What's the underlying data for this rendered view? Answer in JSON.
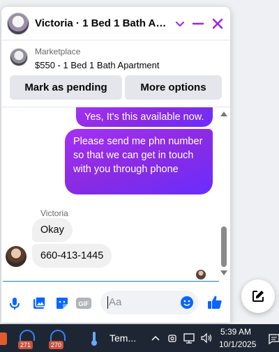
{
  "chat": {
    "title": "Victoria · 1 Bed 1 Bath Apa...",
    "product_label": "Marketplace",
    "product_title": "$550 - 1 Bed 1 Bath Apartment",
    "actions": {
      "mark_pending": "Mark as pending",
      "more_options": "More options"
    },
    "messages": {
      "out_1": "Yes, It's this available now.",
      "out_2": "Please send me  phn number so that we can get in touch with you through phone",
      "sender_name": "Victoria",
      "in_1": "Okay",
      "in_2": "660-413-1445"
    },
    "composer": {
      "placeholder": "Aa"
    }
  },
  "taskbar": {
    "badge_1": "271",
    "badge_2": "270",
    "weather_label": "Tem...",
    "time": "5:39 AM",
    "date": "10/1/2025"
  },
  "colors": {
    "accent": "#8a2be2",
    "brand_blue": "#0866ff",
    "header_purple": "#a020f0"
  },
  "icons": [
    "chevron-down-icon",
    "minimize-icon",
    "close-icon",
    "microphone-icon",
    "photo-icon",
    "sticker-icon",
    "gif-icon",
    "emoji-icon",
    "like-icon",
    "new-message-icon",
    "chevron-up-icon",
    "taskbar-weather-icon",
    "network-icon",
    "volume-icon"
  ]
}
